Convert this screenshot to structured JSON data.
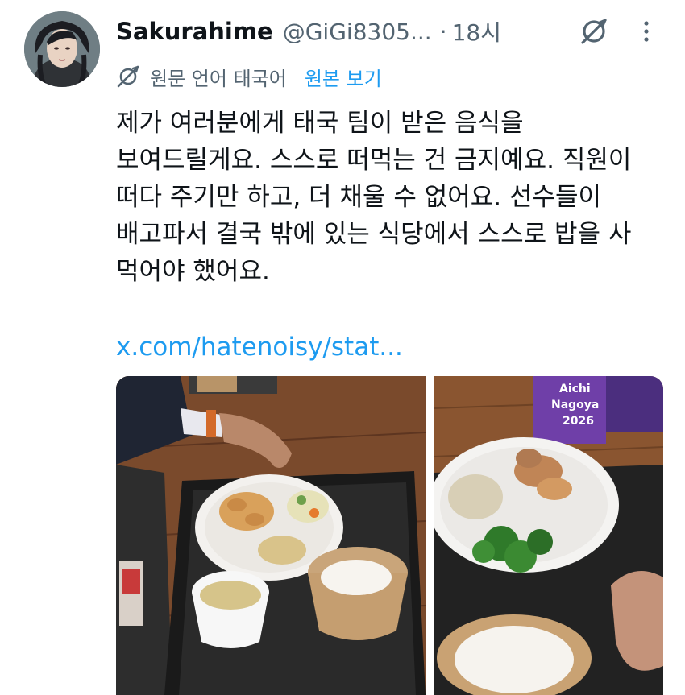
{
  "author": {
    "display_name": "Sakurahime",
    "handle": "@GiGi8305...",
    "separator": "·",
    "time": "18시"
  },
  "icons": {
    "grok": "grok-icon",
    "more": "more-icon",
    "translate": "translate-icon"
  },
  "translation": {
    "label": "원문 언어 태국어",
    "show_original": "원본 보기"
  },
  "tweet_text": [
    "제가 여러분에게 태국 팀이 받은 음식을",
    "보여드릴게요. 스스로 떠먹는 건 금지예요. 직원이",
    "떠다 주기만 하고, 더 채울 수 없어요. 선수들이",
    "배고파서 결국 밖에 있는 식당에서 스스로 밥을 사",
    "먹어야 했어요."
  ],
  "link_text": "x.com/hatenoisy/stat...",
  "media": {
    "photo2_sign_text": [
      "Aichi",
      "Nagoya",
      "2026"
    ]
  },
  "colors": {
    "text": "#0f1419",
    "secondary": "#536471",
    "link": "#1d9bf0"
  }
}
